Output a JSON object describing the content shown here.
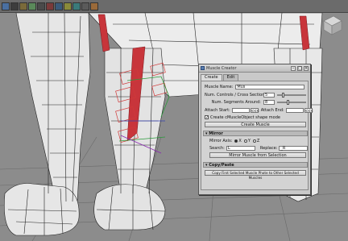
{
  "shelf": {
    "icons": [
      "shelf-tool-1",
      "shelf-tool-2",
      "shelf-tool-3",
      "shelf-tool-4",
      "shelf-tool-5",
      "shelf-tool-6",
      "shelf-tool-7",
      "shelf-tool-8",
      "shelf-tool-9",
      "shelf-tool-10",
      "shelf-tool-11"
    ]
  },
  "window": {
    "title": "Muscle Creator",
    "tabs": [
      "Create",
      "Edit"
    ],
    "muscle_name_label": "Muscle Name:",
    "muscle_name_value": "Mus",
    "num_controls_label": "Num. Controls / Cross Sections:",
    "num_controls_value": "5",
    "num_segments_label": "Num. Segments Around:",
    "num_segments_value": "8",
    "attach_start_label": "Attach Start:",
    "attach_start_btn": "<<<",
    "attach_end_label": "Attach End:",
    "attach_end_btn": "<<<",
    "create_shape_mode_label": "Create cMuscleObject shape mode",
    "create_shape_mode_checked": true,
    "create_button": "Create Muscle",
    "mirror_section": "Mirror",
    "mirror_axis_label": "Mirror Axis:",
    "axes": [
      "X",
      "Y",
      "Z"
    ],
    "mirror_axis_selected": "X",
    "search_label": "Search:",
    "search_value": "L",
    "replace_label": "Replace:",
    "replace_value": "_R",
    "mirror_button": "Mirror Muscle from Selection",
    "copypaste_section": "Copy/Paste",
    "copy_button": "Copy First Selected Muscle Phote to Other Selected Muscles"
  },
  "colors": {
    "viewport_bg": "#8c8c8c",
    "accent_muscle": "#c8353b",
    "wire": "#1a1a1a",
    "grid": "#5e5e5e"
  }
}
